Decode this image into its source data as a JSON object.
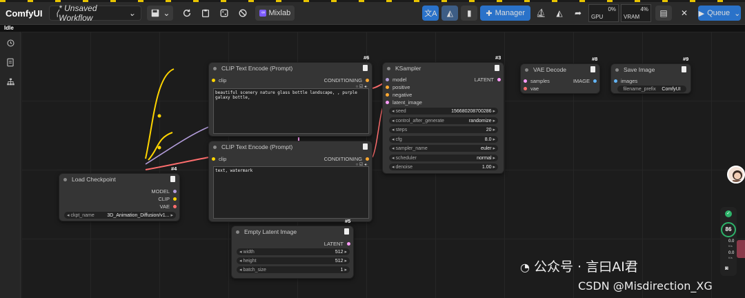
{
  "app": {
    "name": "ComfyUI",
    "status": "Idle"
  },
  "toolbar": {
    "workflow_name": "* Unsaved Workflow",
    "mixlab_label": "Mixlab",
    "manager_label": "Manager",
    "gpu_label": "GPU",
    "gpu_pct": "0%",
    "vram_label": "VRAM",
    "vram_pct": "4%",
    "queue_label": "Queue"
  },
  "nodes": {
    "n6": {
      "id": "#6",
      "title": "CLIP Text Encode (Prompt)",
      "input": "clip",
      "output": "CONDITIONING",
      "text": "beautiful scenery nature glass bottle landscape, , purple galaxy bottle,"
    },
    "n7": {
      "title": "CLIP Text Encode (Prompt)",
      "input": "clip",
      "output": "CONDITIONING",
      "text": "text, watermark"
    },
    "n3": {
      "id": "#3",
      "title": "KSampler",
      "inputs": [
        "model",
        "positive",
        "negative",
        "latent_image"
      ],
      "output": "LATENT",
      "widgets": [
        {
          "name": "seed",
          "value": "156680208700286"
        },
        {
          "name": "control_after_generate",
          "value": "randomize"
        },
        {
          "name": "steps",
          "value": "20"
        },
        {
          "name": "cfg",
          "value": "8.0"
        },
        {
          "name": "sampler_name",
          "value": "euler"
        },
        {
          "name": "scheduler",
          "value": "normal"
        },
        {
          "name": "denoise",
          "value": "1.00"
        }
      ]
    },
    "n8": {
      "id": "#8",
      "title": "VAE Decode",
      "inputs": [
        "samples",
        "vae"
      ],
      "output": "IMAGE"
    },
    "n9": {
      "id": "#9",
      "title": "Save Image",
      "input": "images",
      "widget": {
        "name": "filename_prefix",
        "value": "ComfyUI"
      }
    },
    "n4": {
      "id": "#4",
      "title": "Load Checkpoint",
      "outputs": [
        "MODEL",
        "CLIP",
        "VAE"
      ],
      "widget": {
        "name": "ckpt_name",
        "value": "3D_Animation_Diffusion/v1..."
      }
    },
    "n5": {
      "id": "#5",
      "title": "Empty Latent Image",
      "output": "LATENT",
      "widgets": [
        {
          "name": "width",
          "value": "512"
        },
        {
          "name": "height",
          "value": "512"
        },
        {
          "name": "batch_size",
          "value": "1"
        }
      ]
    }
  },
  "monitor": {
    "value": "86",
    "unit": "%",
    "up": "0.0",
    "down": "0.0",
    "rate_unit": "K/s"
  },
  "watermark": {
    "line1": "公众号 · 言曰AI君",
    "line2": "CSDN @Misdirection_XG"
  },
  "colors": {
    "accent": "#2a72c9",
    "model": "#b39ddb",
    "clip": "#ffd500",
    "vae": "#ff6e6e",
    "conditioning": "#ffa931",
    "latent": "#ff9cf9",
    "image": "#64b5f6"
  }
}
